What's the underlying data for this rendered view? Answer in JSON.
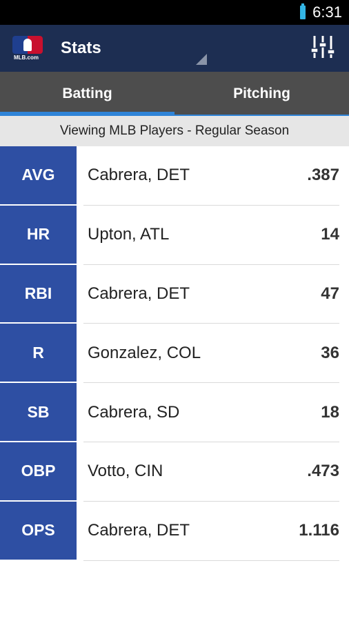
{
  "status_bar": {
    "time": "6:31"
  },
  "action_bar": {
    "logo_text": "MLB.com",
    "title": "Stats"
  },
  "tabs": [
    {
      "label": "Batting",
      "active": true
    },
    {
      "label": "Pitching",
      "active": false
    }
  ],
  "subheader": "Viewing MLB Players - Regular Season",
  "stats": [
    {
      "abbr": "AVG",
      "player": "Cabrera, DET",
      "value": ".387"
    },
    {
      "abbr": "HR",
      "player": "Upton, ATL",
      "value": "14"
    },
    {
      "abbr": "RBI",
      "player": "Cabrera, DET",
      "value": "47"
    },
    {
      "abbr": "R",
      "player": "Gonzalez, COL",
      "value": "36"
    },
    {
      "abbr": "SB",
      "player": "Cabrera, SD",
      "value": "18"
    },
    {
      "abbr": "OBP",
      "player": "Votto, CIN",
      "value": ".473"
    },
    {
      "abbr": "OPS",
      "player": "Cabrera, DET",
      "value": "1.116"
    }
  ],
  "colors": {
    "action_bar": "#1d2e52",
    "tab_bar": "#4d4d4d",
    "tab_indicator": "#2f84d8",
    "stat_badge": "#2e4fa3"
  },
  "icons": {
    "battery": "battery-icon",
    "logo": "mlb-logo-icon",
    "filter": "filter-sliders-icon"
  }
}
